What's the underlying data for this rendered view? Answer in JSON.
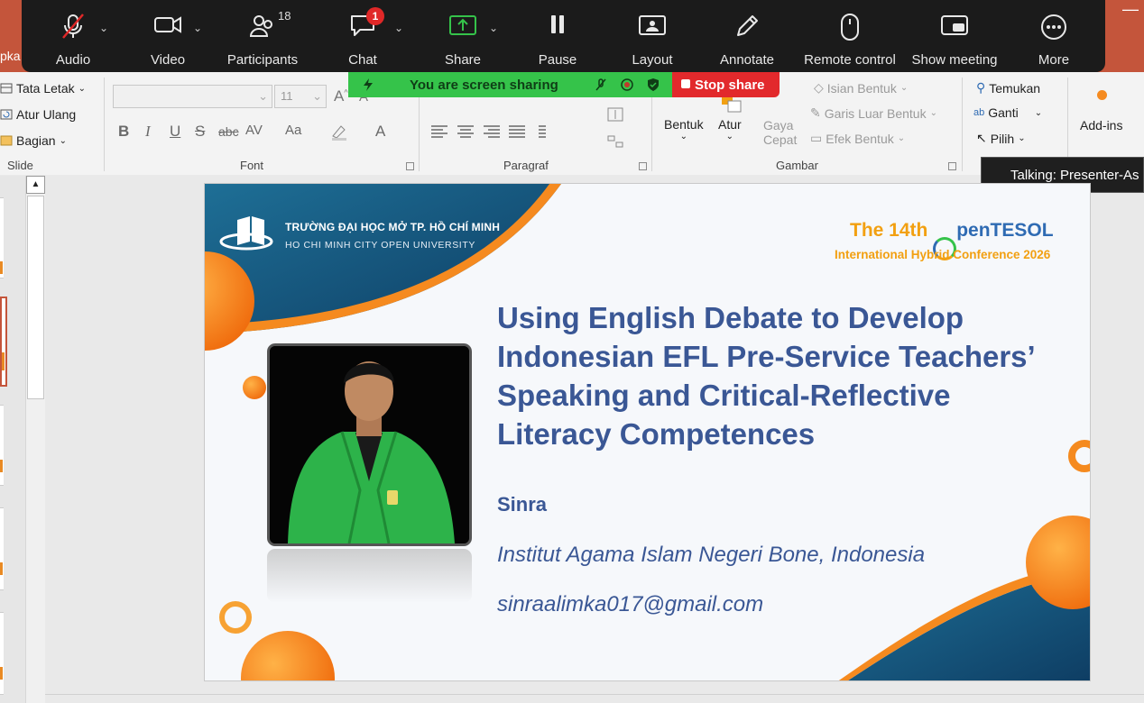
{
  "zoom_toolbar": {
    "buttons": [
      {
        "key": "audio",
        "label": "Audio",
        "icon": "microphone-muted-icon"
      },
      {
        "key": "video",
        "label": "Video",
        "icon": "video-camera-icon"
      },
      {
        "key": "participants",
        "label": "Participants",
        "icon": "participants-icon",
        "count": "18"
      },
      {
        "key": "chat",
        "label": "Chat",
        "icon": "chat-bubble-icon",
        "badge": "1"
      },
      {
        "key": "share",
        "label": "Share",
        "icon": "share-screen-icon"
      },
      {
        "key": "pause",
        "label": "Pause",
        "icon": "pause-icon"
      },
      {
        "key": "layout",
        "label": "Layout",
        "icon": "layout-icon"
      },
      {
        "key": "annotate",
        "label": "Annotate",
        "icon": "pencil-icon"
      },
      {
        "key": "remote",
        "label": "Remote control",
        "icon": "mouse-icon"
      },
      {
        "key": "show_meeting",
        "label": "Show meeting",
        "icon": "show-meeting-icon"
      },
      {
        "key": "more",
        "label": "More",
        "icon": "more-dots-icon"
      }
    ],
    "sharing_banner": "You are screen sharing",
    "stop_share": "Stop share",
    "colors": {
      "bar": "#1b1b1b",
      "share_green": "#35c34a",
      "stop_red": "#e2292c",
      "muted_red": "#e02828"
    }
  },
  "talking_tooltip": "Talking: Presenter-As",
  "ribbon": {
    "window_left_text": "pka",
    "slide_group": {
      "label": "Slide",
      "items": [
        "Tata Letak",
        "Atur Ulang",
        "Bagian"
      ]
    },
    "font_group": {
      "label": "Font",
      "font_size": "11",
      "buttons": [
        "B",
        "I",
        "U",
        "S",
        "abc",
        "AV",
        "Aa",
        "A"
      ]
    },
    "paragraph_group": {
      "label": "Paragraf"
    },
    "drawing_group": {
      "label": "Gambar",
      "bentuk": "Bentuk",
      "atur": "Atur",
      "gaya": "Gaya",
      "cepat": "Cepat",
      "isian": "Isian Bentuk",
      "garis": "Garis Luar Bentuk",
      "efek": "Efek Bentuk"
    },
    "editing_group": {
      "temukan": "Temukan",
      "ganti": "Ganti",
      "pilih": "Pilih"
    },
    "addins": "Add-ins",
    "accent": "#c4553b"
  },
  "slide": {
    "university_name": "TRƯỜNG ĐẠI HỌC MỞ TP. HỒ CHÍ MINH",
    "university_en": "HO CHI MINH CITY OPEN UNIVERSITY",
    "conference_prefix": "The 14th ",
    "conference_brand_a": "O",
    "conference_brand_b": "penTESOL",
    "conference_sub": "International Hybrid Conference 2026",
    "title": "Using English Debate to Develop Indonesian EFL Pre-Service Teachers’ Speaking and Critical-Reflective Literacy Competences",
    "presenter": "Sinra",
    "affiliation": "Institut Agama Islam Negeri Bone, Indonesia",
    "email": "sinraalimka017@gmail.com",
    "colors": {
      "title_blue": "#3a5795",
      "orange": "#f58a1f",
      "teal": "#1e6f96",
      "gold": "#f2a011"
    }
  }
}
